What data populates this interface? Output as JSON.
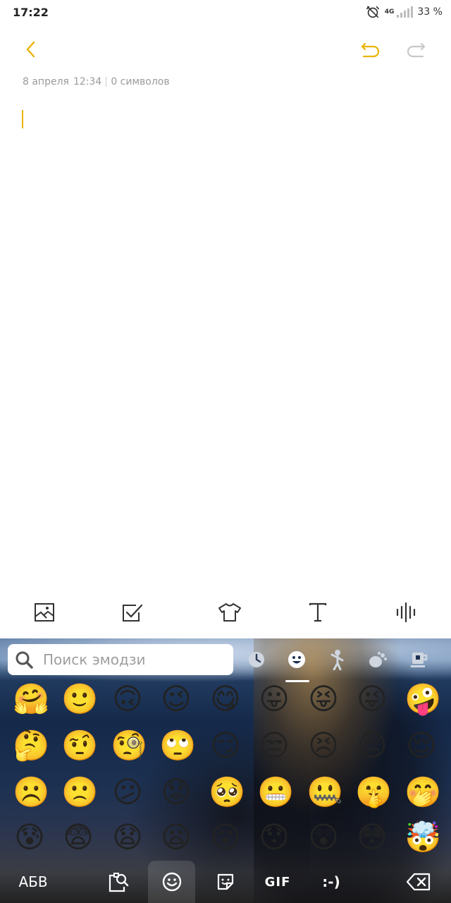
{
  "status_bar": {
    "time": "17:22",
    "network": "4G",
    "battery": "33 %"
  },
  "toolbar": {
    "back_icon": "chevron-left-icon",
    "undo_icon": "undo-icon",
    "redo_icon": "redo-icon",
    "accent_color": "#e9b400"
  },
  "note": {
    "date": "8 апреля",
    "time": "12:34",
    "char_count": "0 символов",
    "body": ""
  },
  "format_bar": {
    "items": [
      "image-icon",
      "checkbox-icon",
      "tshirt-icon",
      "text-format-icon",
      "voice-icon"
    ]
  },
  "keyboard": {
    "search_placeholder": "Поиск эмодзи",
    "categories": [
      "recent-icon",
      "smileys-icon",
      "people-icon",
      "nature-icon",
      "food-icon"
    ],
    "selected_category": "smileys-icon",
    "emoji_rows": [
      [
        "🤗",
        "🙂",
        "🙃",
        "😉",
        "😋",
        "😛",
        "😝",
        "😜",
        "🤪"
      ],
      [
        "🤔",
        "🤨",
        "🧐",
        "🙄",
        "😏",
        "😒",
        "😣",
        "😔",
        "😌"
      ],
      [
        "☹️",
        "🙁",
        "😕",
        "😟",
        "🥺",
        "😬",
        "🤐",
        "🤫",
        "🤭"
      ],
      [
        "😰",
        "😨",
        "😧",
        "😦",
        "😮",
        "😯",
        "😲",
        "😳",
        "🤯"
      ]
    ],
    "bottom": {
      "abc_label": "АБВ",
      "gif_label": "GIF",
      "emoticon_label": ":-)"
    }
  }
}
